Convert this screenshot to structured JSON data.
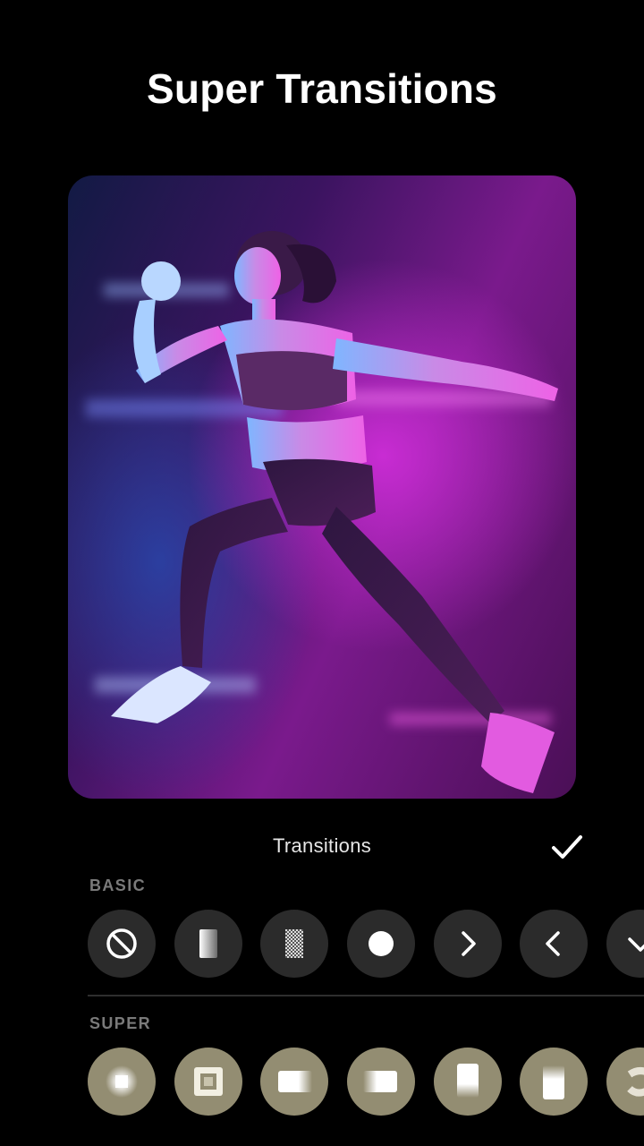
{
  "headline": "Super Transitions",
  "panel": {
    "title": "Transitions",
    "confirm_icon": "check-icon"
  },
  "sections": {
    "basic": {
      "label": "BASIC",
      "items": [
        "none-icon",
        "fade-gradient-icon",
        "dissolve-checker-icon",
        "circle-icon",
        "chevron-right-icon",
        "chevron-left-icon",
        "chevron-down-icon"
      ]
    },
    "super": {
      "label": "SUPER",
      "items": [
        "zoom-blur-icon",
        "frame-zoom-icon",
        "slide-blur-right-icon",
        "slide-blur-left-icon",
        "slide-blur-up-icon",
        "slide-blur-down-icon",
        "swirl-blur-icon"
      ]
    }
  },
  "colors": {
    "background": "#000000",
    "basic_chip": "#2b2b2b",
    "super_chip": "#938d72",
    "section_label": "#7a7a7a"
  }
}
